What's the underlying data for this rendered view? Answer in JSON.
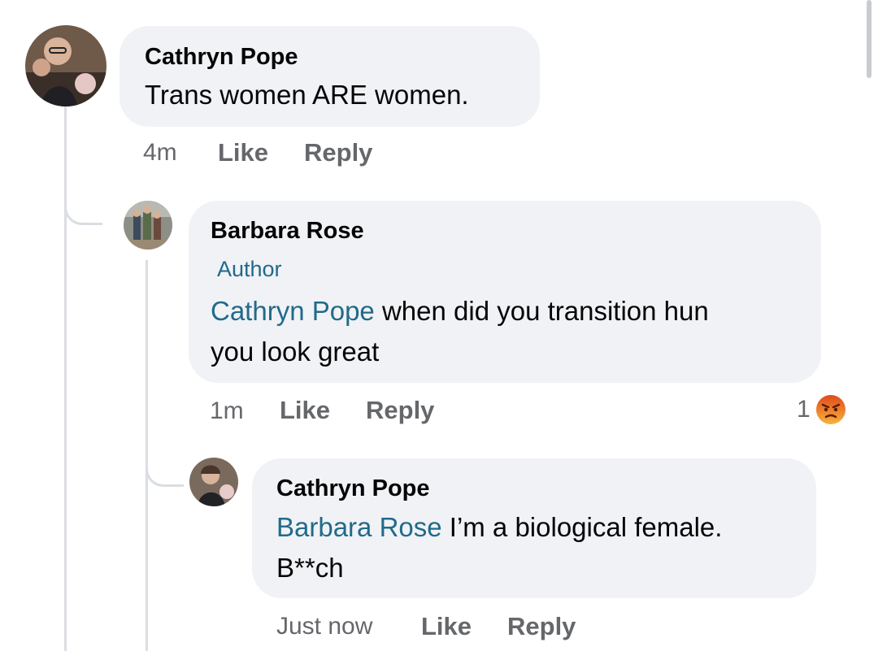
{
  "comments": [
    {
      "author": "Cathryn Pope",
      "text": "Trans women ARE women.",
      "time": "4m",
      "like_label": "Like",
      "reply_label": "Reply"
    },
    {
      "author": "Barbara Rose",
      "badge": "Author",
      "mention": "Cathryn Pope",
      "text_line1": " when did you transition hun",
      "text_line2": "you look great",
      "time": "1m",
      "like_label": "Like",
      "reply_label": "Reply",
      "reaction_count": "1",
      "reaction_icon": "angry-emoji-icon"
    },
    {
      "author": "Cathryn Pope",
      "mention": "Barbara Rose",
      "text_line1": " I’m a biological female.",
      "text_line2": "B**ch",
      "time": "Just now",
      "like_label": "Like",
      "reply_label": "Reply"
    }
  ],
  "colors": {
    "bubble": "#f0f2f5",
    "mention": "#216a8a",
    "meta": "#65676b",
    "angry": "#e9710f"
  }
}
